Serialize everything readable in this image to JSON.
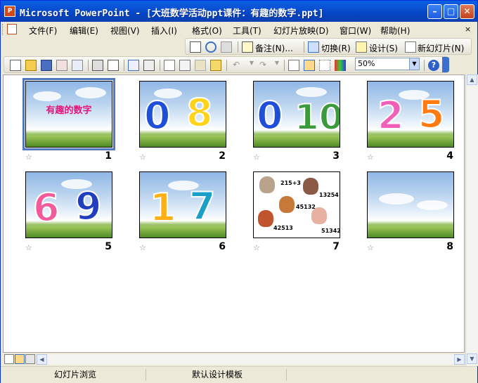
{
  "window": {
    "title": "Microsoft PowerPoint - [大班数学活动ppt课件：有趣的数字.ppt]",
    "buttons": {
      "minimize": "–",
      "maximize": "□",
      "close": "✕"
    }
  },
  "menu": {
    "items": [
      {
        "label": "文件(F)"
      },
      {
        "label": "编辑(E)"
      },
      {
        "label": "视图(V)"
      },
      {
        "label": "插入(I)"
      },
      {
        "label": "格式(O)"
      },
      {
        "label": "工具(T)"
      },
      {
        "label": "幻灯片放映(D)"
      },
      {
        "label": "窗口(W)"
      },
      {
        "label": "帮助(H)"
      }
    ]
  },
  "toolbar_top": {
    "notes_label": "备注(N)...",
    "transition_label": "切换(R)",
    "design_label": "设计(S)",
    "new_slide_label": "新幻灯片(N)"
  },
  "toolbar_std": {
    "zoom_value": "50%",
    "help_label": "?"
  },
  "slides": [
    {
      "number": "1",
      "title": "有趣的数字",
      "selected": true
    },
    {
      "number": "2",
      "digits": [
        "0",
        "8"
      ]
    },
    {
      "number": "3",
      "digits": [
        "0",
        "10"
      ]
    },
    {
      "number": "4",
      "digits": [
        "2",
        "5"
      ]
    },
    {
      "number": "5",
      "digits": [
        "6",
        "9"
      ]
    },
    {
      "number": "6",
      "digits": [
        "1",
        "7"
      ]
    },
    {
      "number": "7",
      "labels": [
        "215+3",
        "13254",
        "45132",
        "42513",
        "51342"
      ]
    },
    {
      "number": "8"
    }
  ],
  "slide_star": "☆",
  "status_bar": {
    "view": "幻灯片浏览",
    "template": "默认设计模板"
  },
  "colors": {
    "titlebar": "#0a4fd1",
    "selection": "#5078c0",
    "title_pink": "#e4157a"
  }
}
